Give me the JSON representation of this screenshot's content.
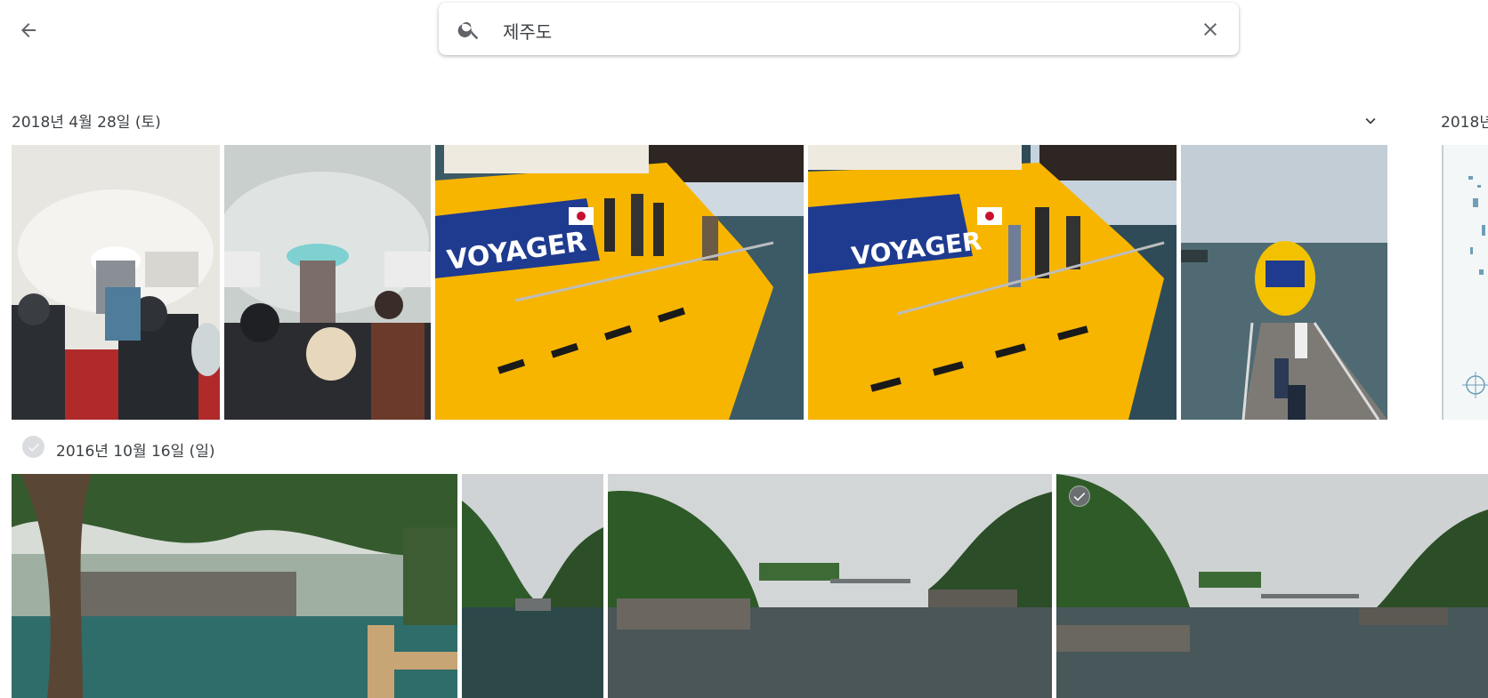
{
  "header": {
    "back_icon": "arrow-left-icon",
    "search": {
      "value": "제주도",
      "search_icon": "search-icon",
      "clear_icon": "close-icon"
    }
  },
  "groups": [
    {
      "date_label": "2018년 4월 28일 (토)",
      "collapse_icon": "chevron-down-icon"
    },
    {
      "date_label": "2016년 10월 16일 (일)",
      "select_icon": "check-circle-icon"
    }
  ],
  "next_group": {
    "date_label_partial": "2018년"
  },
  "photos": {
    "row1": [
      "submarine-interior-1",
      "submarine-interior-2",
      "voyager-submarine-1",
      "voyager-submarine-2",
      "pier-boat"
    ],
    "row2": [
      "coast-trees",
      "coast-inlet-narrow",
      "coast-inlet-wide-1",
      "coast-inlet-wide-2"
    ]
  },
  "colors": {
    "accent": "#1a73e8",
    "submarine_yellow": "#f7b500",
    "submarine_blue": "#1f3b8f",
    "sea": "#3b5a66"
  }
}
